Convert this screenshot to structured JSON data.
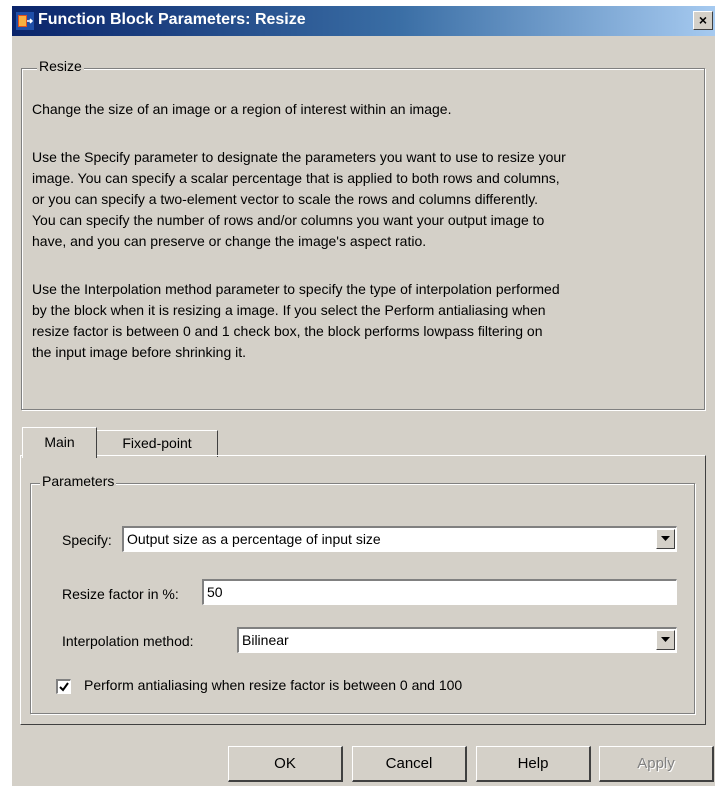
{
  "window": {
    "title": "Function Block Parameters: Resize",
    "close_label": "×"
  },
  "description": {
    "group_label": "Resize",
    "paragraphs": [
      "Change the size of an image or a region of interest within an image.",
      "Use the Specify parameter to designate the parameters you want to use to resize your\nimage. You can specify a scalar percentage that is applied to both rows and columns,\nor you can specify a two-element vector to scale the rows and columns differently.\nYou can specify the number of rows and/or columns you want your output image to\nhave, and you can preserve or change the image's aspect ratio.",
      "Use the Interpolation method parameter to specify the type of interpolation performed\nby the block when it is resizing a image. If you select the Perform antialiasing when\nresize factor is between 0 and 1 check box, the block performs lowpass filtering on\nthe input image before shrinking it."
    ]
  },
  "tabs": [
    {
      "label": "Main",
      "active": true
    },
    {
      "label": "Fixed-point",
      "active": false
    }
  ],
  "parameters": {
    "group_label": "Parameters",
    "specify": {
      "label": "Specify:",
      "value": "Output size as a percentage of input size"
    },
    "resize_factor": {
      "label": "Resize factor in %:",
      "value": "50"
    },
    "interpolation": {
      "label": "Interpolation method:",
      "value": "Bilinear"
    },
    "antialias": {
      "label": "Perform antialiasing when resize factor is between 0 and 100",
      "checked": true
    }
  },
  "buttons": {
    "ok": "OK",
    "cancel": "Cancel",
    "help": "Help",
    "apply": "Apply"
  }
}
